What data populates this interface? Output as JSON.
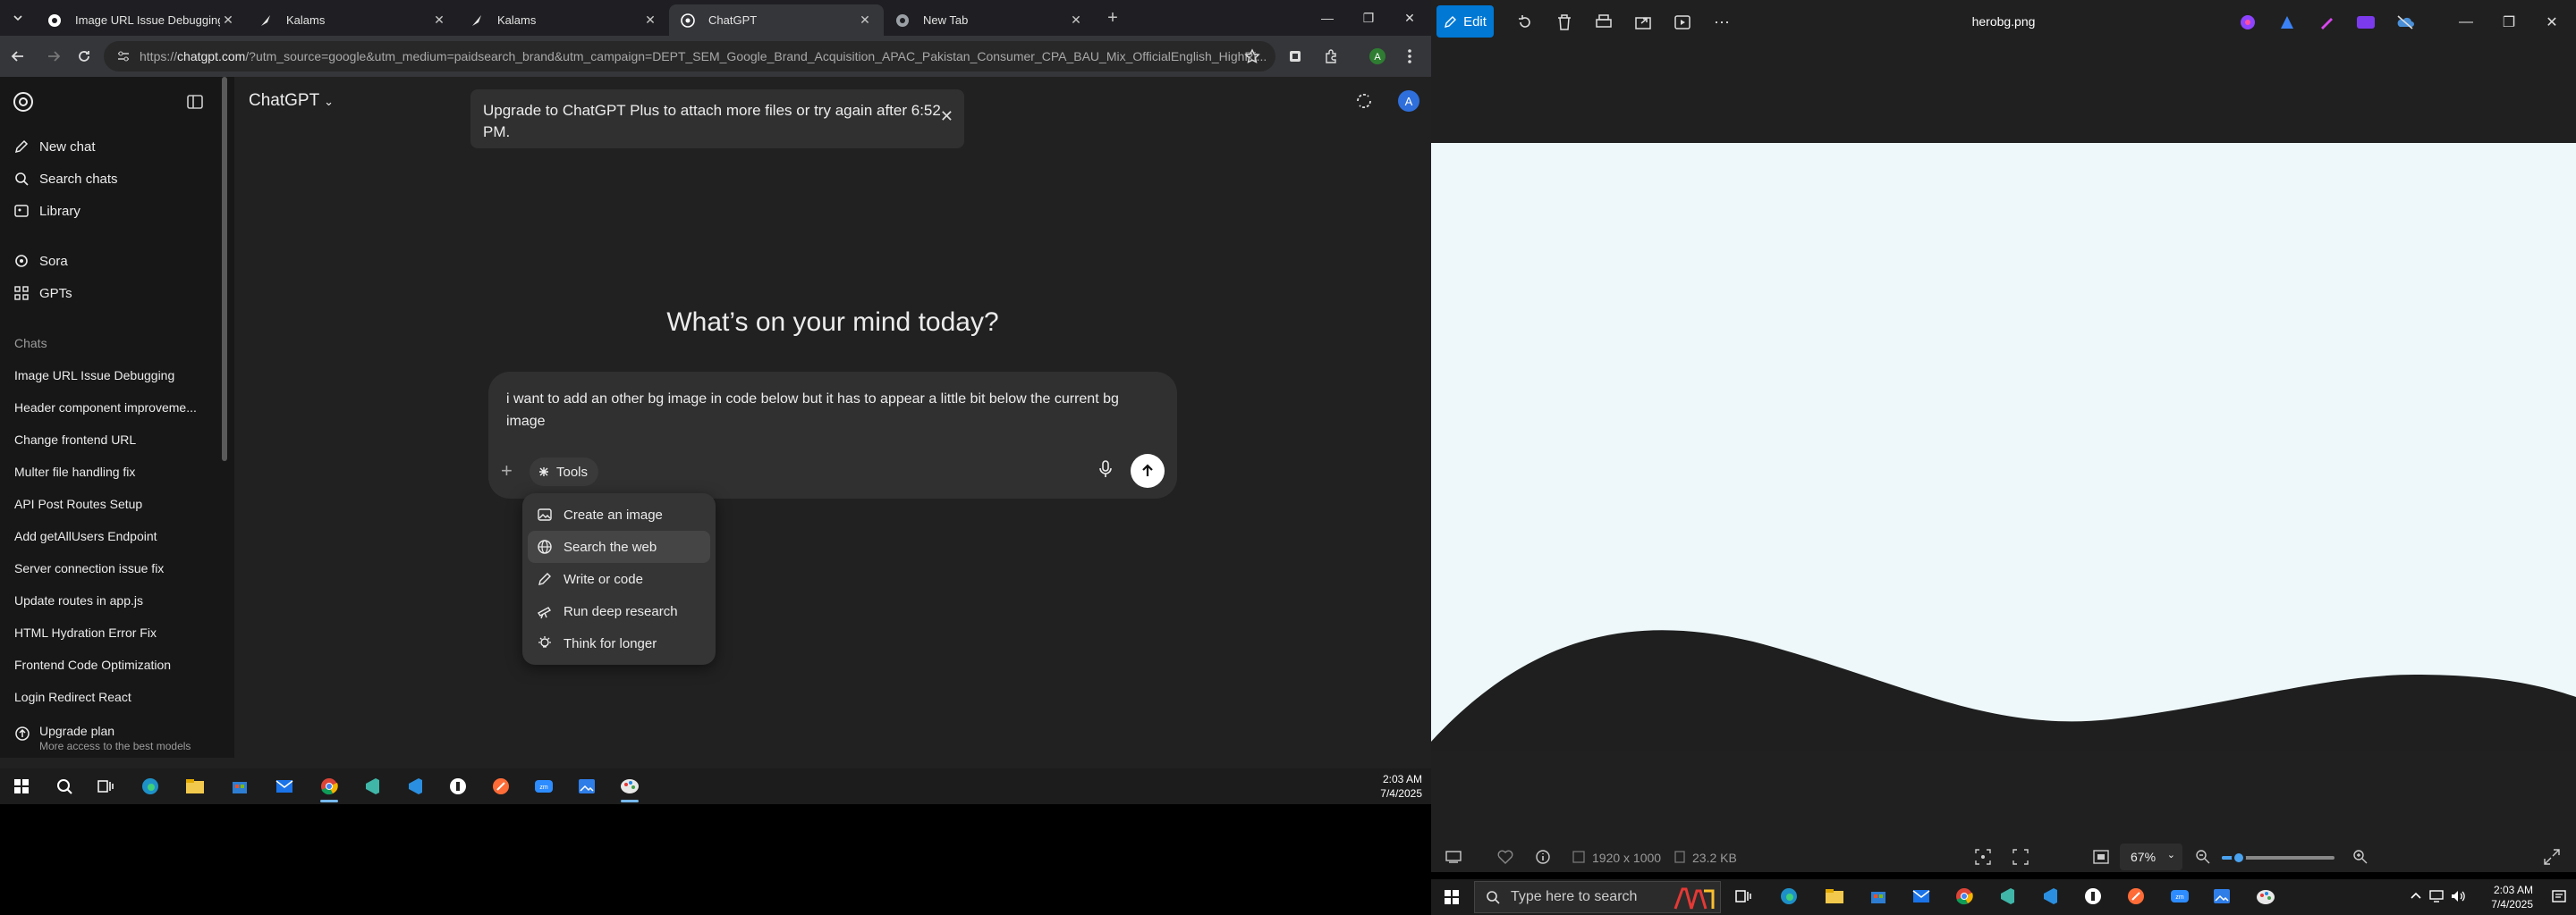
{
  "chrome": {
    "tabs": [
      {
        "title": "Image URL Issue Debugging",
        "active": false
      },
      {
        "title": "Kalams",
        "active": false
      },
      {
        "title": "Kalams",
        "active": false
      },
      {
        "title": "ChatGPT",
        "active": true
      },
      {
        "title": "New Tab",
        "active": false
      }
    ],
    "url_prefix": "https://",
    "url_host": "chatgpt.com",
    "url_rest": "/?utm_source=google&utm_medium=paidsearch_brand&utm_campaign=DEPT_SEM_Google_Brand_Acquisition_APAC_Pakistan_Consumer_CPA_BAU_Mix_OfficialEnglish_HighRi...",
    "profile_initial": "A"
  },
  "sidebar": {
    "top_items": [
      {
        "label": "New chat",
        "icon": "edit-icon"
      },
      {
        "label": "Search chats",
        "icon": "search-icon"
      },
      {
        "label": "Library",
        "icon": "library-icon"
      }
    ],
    "mid_items": [
      {
        "label": "Sora",
        "icon": "sora-icon"
      },
      {
        "label": "GPTs",
        "icon": "grid-icon"
      }
    ],
    "chats_label": "Chats",
    "chats": [
      "Image URL Issue Debugging",
      "Header component improveme...",
      "Change frontend URL",
      "Multer file handling fix",
      "API Post Routes Setup",
      "Add getAllUsers Endpoint",
      "Server connection issue fix",
      "Update routes in app.js",
      "HTML Hydration Error Fix",
      "Frontend Code Optimization",
      "Login Redirect React"
    ],
    "upgrade_title": "Upgrade plan",
    "upgrade_sub": "More access to the best models"
  },
  "main": {
    "model": "ChatGPT",
    "toast": "Upgrade to ChatGPT Plus to attach more files or try again after 6:52 PM.",
    "headline": "What’s on your mind today?",
    "prompt": "i want to add an other bg image in code below  but it has to appear a little bit below the current bg image",
    "tools_label": "Tools",
    "user_initial": "A",
    "tools_menu": [
      {
        "label": "Create an image",
        "icon": "image-icon"
      },
      {
        "label": "Search the web",
        "icon": "globe-icon"
      },
      {
        "label": "Write or code",
        "icon": "pen-icon"
      },
      {
        "label": "Run deep research",
        "icon": "telescope-icon"
      },
      {
        "label": "Think for longer",
        "icon": "bulb-icon"
      }
    ]
  },
  "taskbar_left": {
    "time": "2:03 AM",
    "date": "7/4/2025"
  },
  "photos": {
    "edit_label": "Edit",
    "title": "herobg.png",
    "dimensions": "1920 x 1000",
    "filesize": "23.2 KB",
    "zoom": "67%",
    "zoom_fraction": 0.15,
    "image_colors": {
      "sky": "#eef8fa",
      "wave": "#1f1f1f"
    }
  },
  "taskbar_right": {
    "search_placeholder": "Type here to search",
    "time": "2:03 AM",
    "date": "7/4/2025"
  }
}
